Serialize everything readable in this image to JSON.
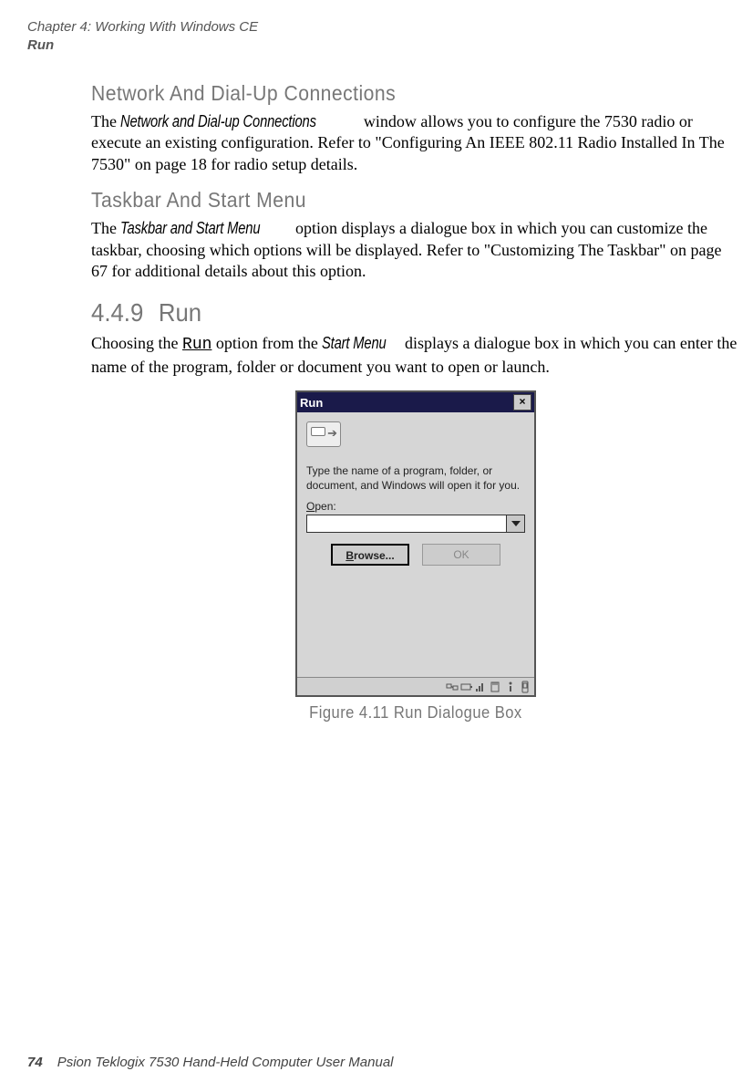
{
  "header": {
    "chapter_line": "Chapter 4:  Working With Windows CE",
    "sub_line": "Run"
  },
  "sections": {
    "net": {
      "title": "Network And Dial-Up Connections",
      "p_pre": "The ",
      "p_em": "Network and Dial-up Connections",
      "p_rest": " window allows you to configure the 7530 radio or execute an existing configuration. Refer to \"Configuring An IEEE 802.11 Radio Installed In The 7530\" on page 18 for radio setup details."
    },
    "taskbar": {
      "title": "Taskbar And Start Menu",
      "p_pre": "The  ",
      "p_em": "Taskbar and Start Menu",
      "p_rest": "  option displays a dialogue box in which you can customize the taskbar, choosing which options will be displayed. Refer to \"Customizing The Taskbar\" on page 67 for additional details about this option."
    },
    "run": {
      "number": "4.4.9",
      "label": "Run",
      "p_pre": "Choosing the ",
      "p_mono": "Run",
      "p_mid": " option from the ",
      "p_em": "Start Menu",
      "p_rest": " displays a dialogue box in which you can enter the name of the program, folder or document you want to open or launch."
    }
  },
  "dialog": {
    "title": "Run",
    "close": "×",
    "prompt": "Type the name of a program, folder, or document, and Windows will open it for you.",
    "open_u": "O",
    "open_rest": "pen:",
    "input_value": "",
    "browse_u": "B",
    "browse_rest": "rowse...",
    "ok": "OK"
  },
  "figure": {
    "caption": "Figure 4.11 Run Dialogue Box"
  },
  "footer": {
    "page_num": "74",
    "text": "Psion Teklogix 7530 Hand-Held Computer User Manual"
  }
}
